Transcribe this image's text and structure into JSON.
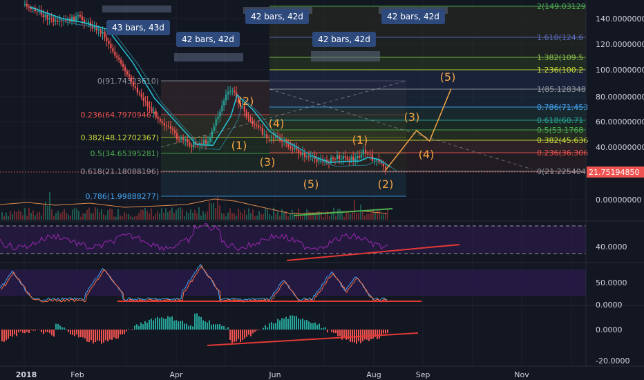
{
  "colors": {
    "background": "#131722",
    "grid": "#1e222d",
    "up": "#26a69a",
    "down": "#ef5350",
    "wave": "#f5a443",
    "ma": "#26c6da",
    "rsi_band": "#311b57",
    "trend": "#e53935",
    "volume_trend": "#4caf50",
    "price_tag": "#ef5350",
    "bars_box": "#2e4a7d"
  },
  "price_axis": {
    "ticks": [
      "140.00000000",
      "120.00000000",
      "100.00000000",
      "80.00000000",
      "60.00000000",
      "40.00000000",
      "0.00000000"
    ],
    "current_price": "21.75194850"
  },
  "rsi_axis": {
    "ticks": [
      "40.0000"
    ]
  },
  "stoch_axis": {
    "ticks": [
      "50.0000",
      "0.0000"
    ]
  },
  "macd_axis": {
    "ticks": [
      "0.0000",
      "-20.0000"
    ]
  },
  "time_axis": {
    "ticks": [
      "2018",
      "Feb",
      "Apr",
      "Jun",
      "Aug",
      "Sep",
      "Nov"
    ]
  },
  "left_fib": [
    {
      "label": "0(91.74323610)",
      "color": "#9598a1"
    },
    {
      "label": "0.236(64.79709467)",
      "color": "#ef5350"
    },
    {
      "label": "0.382(48.12702367)",
      "color": "#cddc39"
    },
    {
      "label": "0.5(34.65395281)",
      "color": "#4caf50"
    },
    {
      "label": "0.618(21.18088196)",
      "color": "#9598a1"
    },
    {
      "label": "0.786(1.99888277)",
      "color": "#42a5f5"
    }
  ],
  "right_fib": [
    {
      "label": "2(149.03129",
      "color": "#4caf50"
    },
    {
      "label": "1.618(124.6",
      "color": "#5c6bc0"
    },
    {
      "label": "1.382(109.5",
      "color": "#8bc34a"
    },
    {
      "label": "1.236(100.2",
      "color": "#cddc39"
    },
    {
      "label": "1(85.128348",
      "color": "#9598a1"
    },
    {
      "label": "0.786(71.453",
      "color": "#42a5f5"
    },
    {
      "label": "0.618(60.71",
      "color": "#26a69a"
    },
    {
      "label": "0.5(53.1768",
      "color": "#4caf50"
    },
    {
      "label": "0.382(45.636",
      "color": "#cddc39"
    },
    {
      "label": "0.236(36.306",
      "color": "#ef5350"
    },
    {
      "label": "0(21.225404",
      "color": "#9598a1"
    }
  ],
  "bars_labels": [
    "43 bars, 43d",
    "42 bars, 42d",
    "42 bars, 42d",
    "42 bars, 42d",
    "42 bars, 42d"
  ],
  "wave_labels": [
    "(1)",
    "(2)",
    "(3)",
    "(4)",
    "(5)",
    "(1)",
    "(2)",
    "(3)",
    "(4)",
    "(5)"
  ],
  "chart_data": {
    "type": "line",
    "title": "",
    "xlabel": "",
    "ylabel": "",
    "x": [
      "2018-01",
      "2018-01-20",
      "2018-02-01",
      "2018-02-15",
      "2018-03-01",
      "2018-03-15",
      "2018-04-01",
      "2018-04-10",
      "2018-04-20",
      "2018-05-01",
      "2018-05-05",
      "2018-05-15",
      "2018-05-25",
      "2018-06-01",
      "2018-06-10",
      "2018-06-20",
      "2018-07-01",
      "2018-07-10",
      "2018-07-20",
      "2018-07-25",
      "2018-08-01",
      "2018-08-08"
    ],
    "series": [
      {
        "values": [
          150,
          135,
          140,
          128,
          95,
          70,
          48,
          42,
          45,
          80,
          84,
          62,
          50,
          48,
          40,
          33,
          29,
          33,
          31,
          37,
          30,
          25
        ]
      }
    ],
    "projection": [
      {
        "x": "2018-08-08",
        "y": 22
      },
      {
        "x": "2018-08-28",
        "y": 53
      },
      {
        "x": "2018-09-05",
        "y": 45
      },
      {
        "x": "2018-09-18",
        "y": 85
      }
    ],
    "ylim": [
      -10,
      150
    ]
  }
}
